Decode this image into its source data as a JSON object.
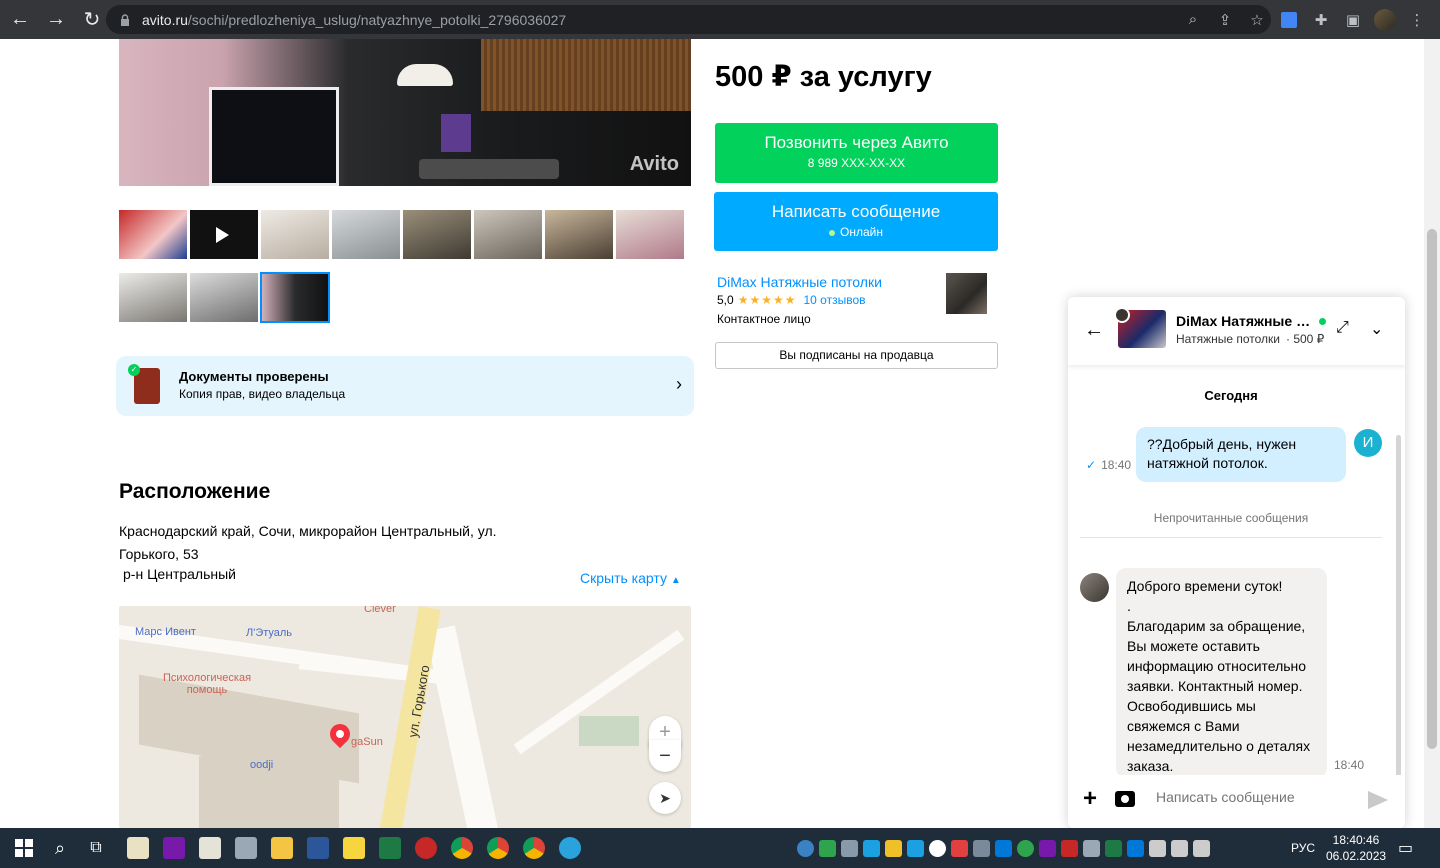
{
  "browser": {
    "url_host": "avito.ru",
    "url_path": "/sochi/predlozheniya_uslug/natyazhnye_potolki_2796036027"
  },
  "listing": {
    "watermark": "Avito",
    "price": "500 ₽ за услугу",
    "call_button": {
      "label": "Позвонить через Авито",
      "phone": "8 989 XXX-XX-XX"
    },
    "message_button": {
      "label": "Написать сообщение",
      "status": "Онлайн"
    },
    "seller": {
      "name": "DiMax Натяжные потолки",
      "rating": "5,0",
      "stars": "★★★★★",
      "reviews": "10 отзывов",
      "role": "Контактное лицо",
      "subscribe_label": "Вы подписаны на продавца"
    },
    "docs_card": {
      "title": "Документы проверены",
      "subtitle": "Копия прав, видео владельца"
    },
    "location": {
      "title": "Расположение",
      "address": "Краснодарский край, Сочи, микрорайон Центральный, ул. Горького, 53",
      "district": "р-н Центральный",
      "hide_map": "Скрыть карту"
    },
    "map": {
      "labels": [
        "Марс Ивент",
        "Л'Этуаль",
        "Психологическая помощь",
        "oodji",
        "gaSun",
        "Clever"
      ],
      "street": "ул. Горького"
    }
  },
  "chat": {
    "title": "DiMax Натяжные потолки",
    "subtitle": "Натяжные потолки",
    "price": "· 500 ₽",
    "day_label": "Сегодня",
    "outgoing": {
      "text": "??Добрый день, нужен натяжной потолок.",
      "time": "18:40",
      "avatar_letter": "И"
    },
    "unread_label": "Непрочитанные сообщения",
    "incoming": {
      "lines": [
        "Доброго времени суток!",
        ".",
        "Благодарим за обращение, Вы можете оставить информацию относительно заявки. Контактный номер. Освободившись мы свяжемся с Вами незамедлительно о деталях заказа."
      ],
      "time": "18:40"
    },
    "input_placeholder": "Написать сообщение"
  },
  "taskbar": {
    "language": "РУС",
    "time": "18:40:46",
    "date": "06.02.2023"
  }
}
